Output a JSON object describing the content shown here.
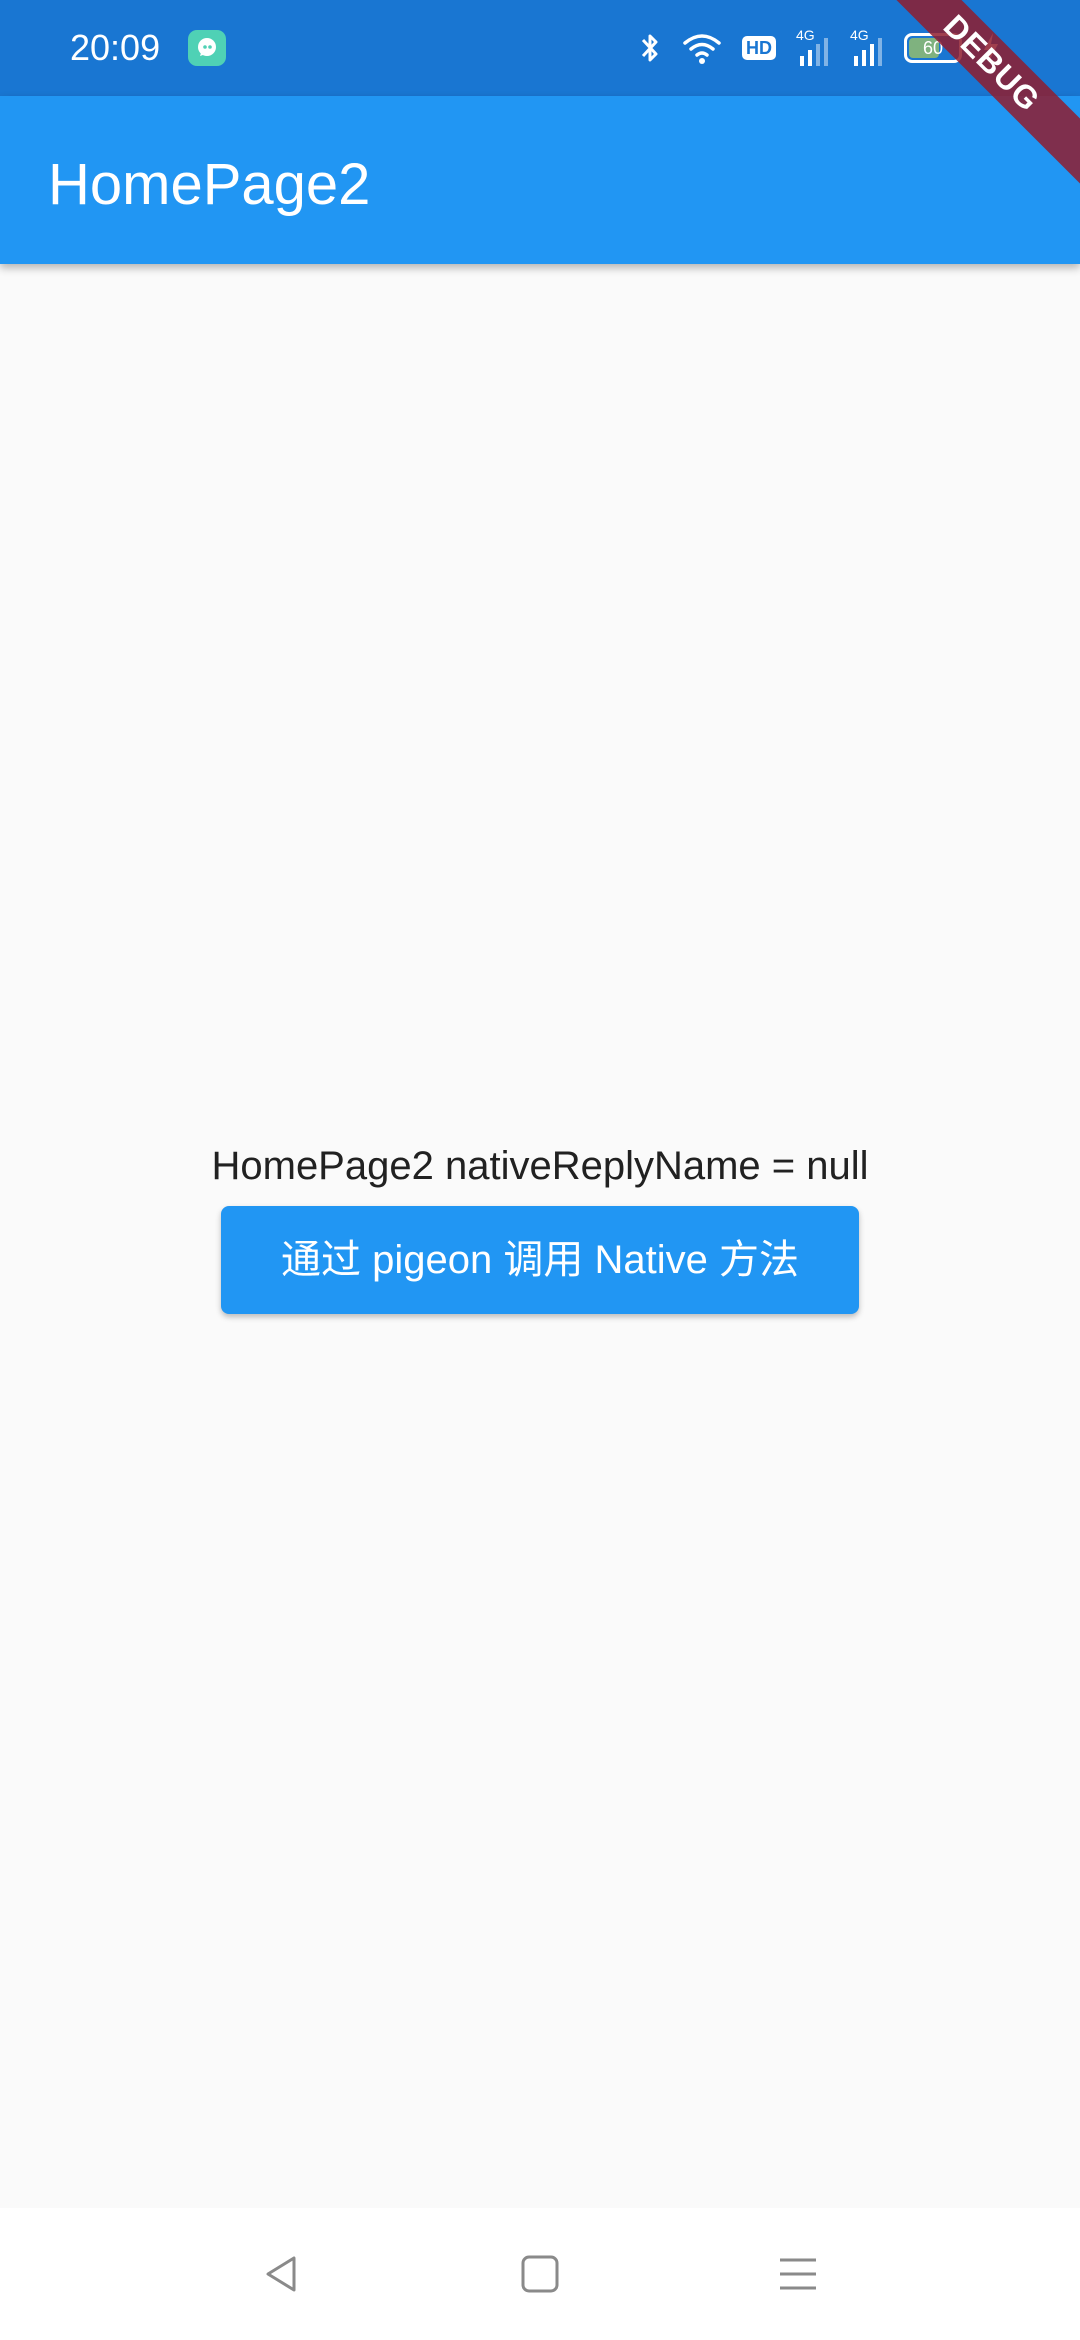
{
  "status_bar": {
    "time": "20:09",
    "app_icon": "chat-bubble-icon",
    "icons": [
      "bluetooth-icon",
      "wifi-icon",
      "hd-badge",
      "signal-4g-icon",
      "signal-4g-icon",
      "battery-icon",
      "charging-icon"
    ],
    "hd_label": "HD",
    "network_1": "4G",
    "network_2": "4G",
    "battery_level": "60"
  },
  "debug_banner": "DEBUG",
  "app_bar": {
    "title": "HomePage2"
  },
  "main": {
    "reply_text": "HomePage2 nativeReplyName = null",
    "button_label": "通过 pigeon 调用 Native 方法"
  },
  "nav_bar": {
    "buttons": [
      "back-icon",
      "home-icon",
      "recents-icon"
    ]
  },
  "colors": {
    "status_bar": "#1976d2",
    "primary": "#2196f3",
    "background": "#fafafa",
    "debug_banner": "#8f1d2f"
  }
}
